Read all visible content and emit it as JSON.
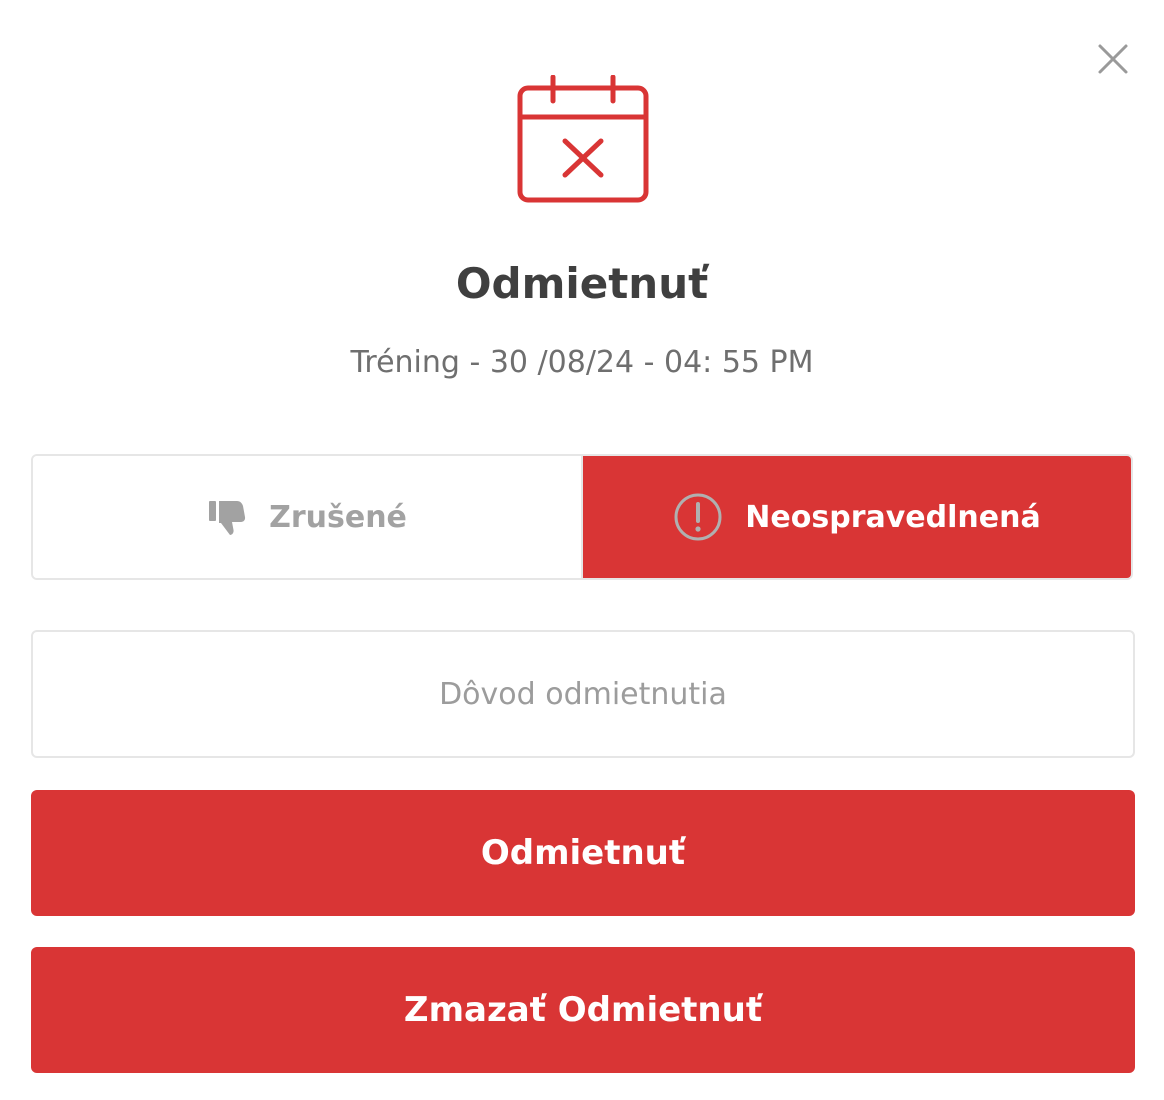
{
  "dialog": {
    "title": "Odmietnuť",
    "subtitle": "Tréning - 30 /08/24 - 04: 55 PM",
    "close_icon": "close-icon",
    "hero_icon": "calendar-x-icon"
  },
  "status_options": [
    {
      "label": "Zrušené",
      "icon": "thumbs-down-icon",
      "selected": false
    },
    {
      "label": "Neospravedlnená",
      "icon": "exclamation-circle-icon",
      "selected": true
    }
  ],
  "reason": {
    "placeholder": "Dôvod odmietnutia",
    "value": ""
  },
  "actions": {
    "reject_label": "Odmietnuť",
    "delete_label": "Zmazať Odmietnuť"
  },
  "colors": {
    "accent": "#d93535",
    "title_text": "#3f3f3f",
    "muted_text": "#a2a2a2",
    "border": "#e6e6e6"
  }
}
